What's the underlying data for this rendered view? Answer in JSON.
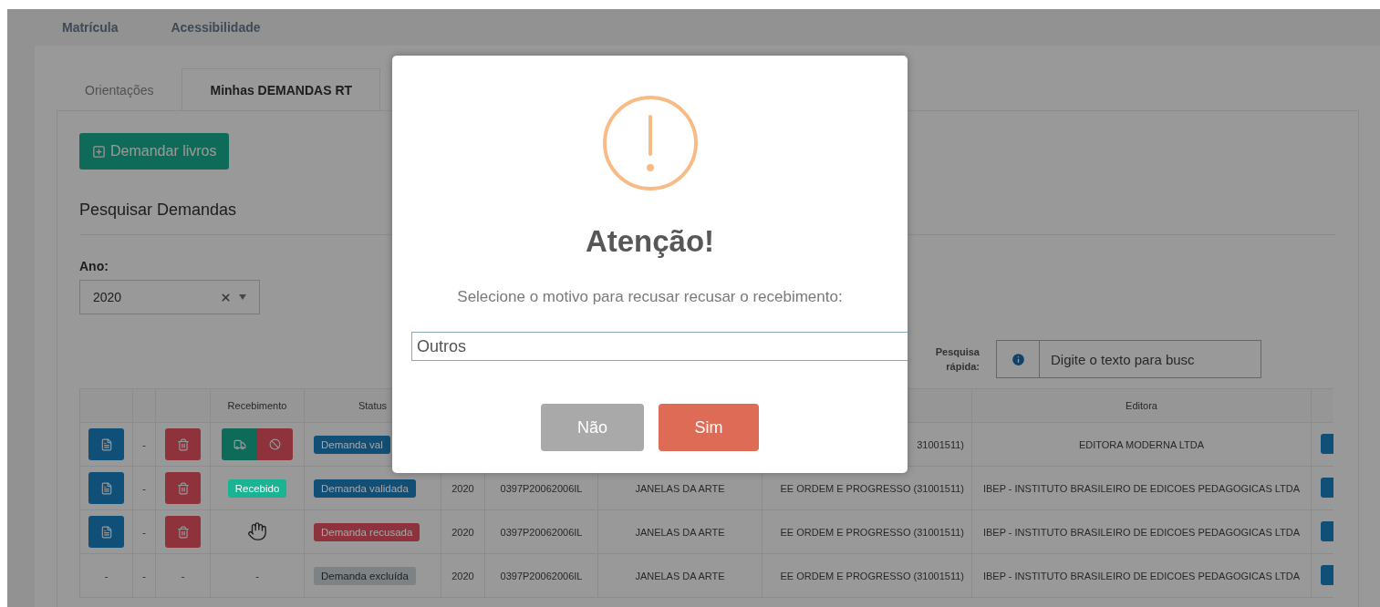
{
  "top_nav": [
    {
      "label": "Matrícula",
      "selected": false
    },
    {
      "label": "Acessibilidade",
      "selected": false
    }
  ],
  "tabs": [
    {
      "label": "Orientações",
      "selected": false
    },
    {
      "label": "Minhas DEMANDAS RT",
      "selected": true
    }
  ],
  "add_button": "Demandar livros",
  "section_title": "Pesquisar Demandas",
  "year_filter": {
    "label": "Ano:",
    "value": "2020"
  },
  "quick_search": {
    "label": "Pesquisa rápida:",
    "placeholder": "Digite o texto para busc"
  },
  "table": {
    "headers": {
      "receipt": "Recebimento",
      "status": "Status",
      "publisher": "Editora"
    },
    "rows": [
      {
        "kind": "actions",
        "separator": "-",
        "receipt": {
          "kind": "split"
        },
        "status": {
          "label": "Demanda val",
          "color": "#114f77"
        },
        "school": "31001511)",
        "publisher": "EDITORA MODERNA LTDA"
      },
      {
        "kind": "actions",
        "separator": "-",
        "receipt": {
          "kind": "badge",
          "text": "Recebido"
        },
        "status": {
          "label": "Demanda validada",
          "color": "#114f77"
        },
        "year": "2020",
        "code": "0397P20062006IL",
        "collection": "JANELAS DA ARTE",
        "school": "EE ORDEM E PROGRESSO (31001511)",
        "publisher": "IBEP - INSTITUTO BRASILEIRO DE EDICOES PEDAGOGICAS LTDA"
      },
      {
        "kind": "actions",
        "separator": "-",
        "receipt": {
          "kind": "hand"
        },
        "status": {
          "label": "Demanda recusada",
          "color": "#8e333d"
        },
        "year": "2020",
        "code": "0397P20062006IL",
        "collection": "JANELAS DA ARTE",
        "school": "EE ORDEM E PROGRESSO (31001511)",
        "publisher": "IBEP - INSTITUTO BRASILEIRO DE EDICOES PEDAGOGICAS LTDA"
      },
      {
        "kind": "dashes",
        "pdf": "-",
        "separator": "-",
        "delete": "-",
        "receipt": {
          "kind": "text",
          "text": "-"
        },
        "status": {
          "label": "Demanda excluída",
          "color": "#7d8385"
        },
        "year": "2020",
        "code": "0397P20062006IL",
        "collection": "JANELAS DA ARTE",
        "school": "EE ORDEM E PROGRESSO (31001511)",
        "publisher": "IBEP - INSTITUTO BRASILEIRO DE EDICOES PEDAGOGICAS LTDA"
      }
    ]
  },
  "modal": {
    "title": "Atenção!",
    "message": "Selecione o motivo para recusar recusar o recebimento:",
    "reason": "Outros",
    "buttons": [
      {
        "label": "Não",
        "kind": "cancel"
      },
      {
        "label": "Sim",
        "kind": "confirm"
      }
    ]
  }
}
